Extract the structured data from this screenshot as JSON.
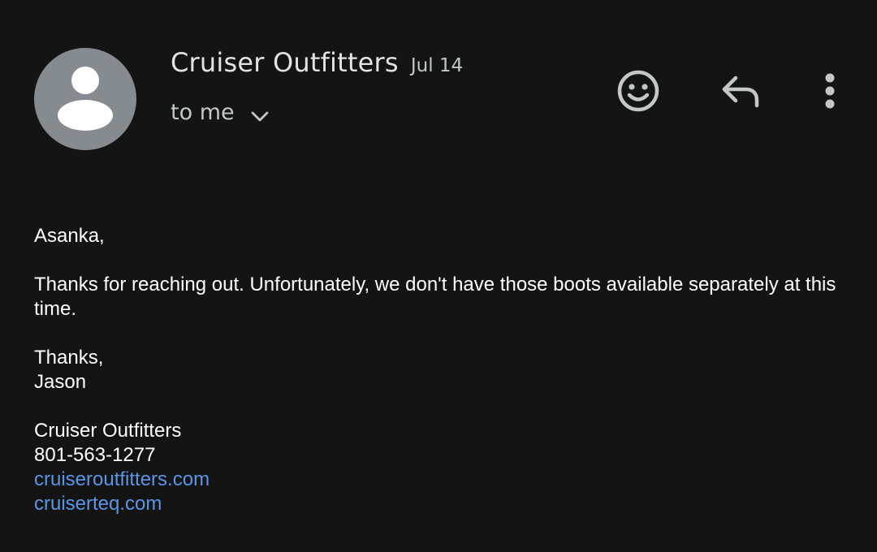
{
  "header": {
    "sender_name": "Cruiser Outfitters",
    "date": "Jul 14",
    "recipient_label": "to me",
    "avatar_icon": "person-icon",
    "actions": {
      "emoji_icon": "smiley-icon",
      "reply_icon": "reply-icon",
      "more_icon": "more-vert-icon"
    }
  },
  "message": {
    "greeting": "Asanka,",
    "body": "Thanks for reaching out. Unfortunately, we don't have those boots available separately at this time.",
    "signoff": "Thanks,",
    "signer": "Jason",
    "signature": {
      "company": "Cruiser Outfitters",
      "phone": "801-563-1277",
      "links": [
        "cruiseroutfitters.com",
        "cruiserteq.com"
      ]
    }
  },
  "colors": {
    "background": "#141414",
    "link": "#5a96e8",
    "avatar": "#868b90",
    "icon": "#c4c7c5"
  }
}
